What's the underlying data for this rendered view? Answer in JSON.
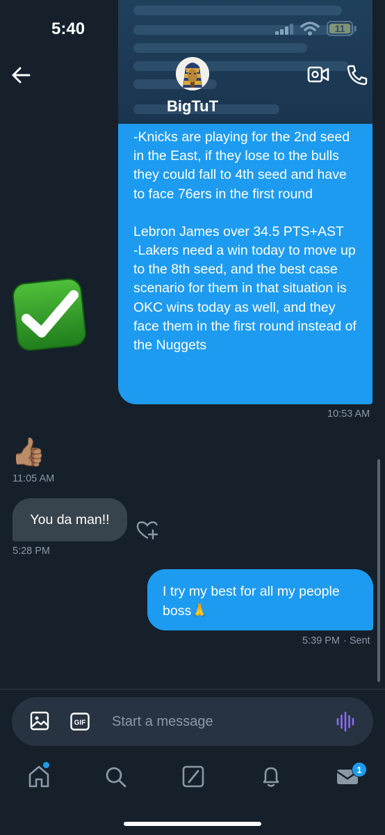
{
  "status_bar": {
    "time": "5:40",
    "battery": "11"
  },
  "header": {
    "name": "BigTuT"
  },
  "messages": {
    "outgoing_main": {
      "paragraph1": "-Knicks are playing for the 2nd seed in the East, if they lose to the bulls they could fall to 4th seed and have to face 76ers in the first round",
      "paragraph2_title": "Lebron James over 34.5 PTS+AST",
      "paragraph2_body": "-Lakers need a win today to move up to the 8th seed, and the best case scenario for them in that situation is OKC wins today as well, and they face them in the first round instead of the Nuggets",
      "time": "10:53 AM"
    },
    "incoming_emoji": {
      "emoji": "👍🏽",
      "time": "11:05 AM"
    },
    "incoming_text": {
      "text": "You da man!!",
      "time": "5:28 PM"
    },
    "outgoing_reply": {
      "text": "I try my best for all my people boss🙏",
      "time": "5:39 PM",
      "status": "· Sent"
    }
  },
  "composer": {
    "placeholder": "Start a message",
    "gif_label": "GIF"
  },
  "tabbar": {
    "messages_badge": "1"
  },
  "colors": {
    "accent": "#1d9bf0",
    "background": "#15202b",
    "incoming_bubble": "#38444d"
  }
}
